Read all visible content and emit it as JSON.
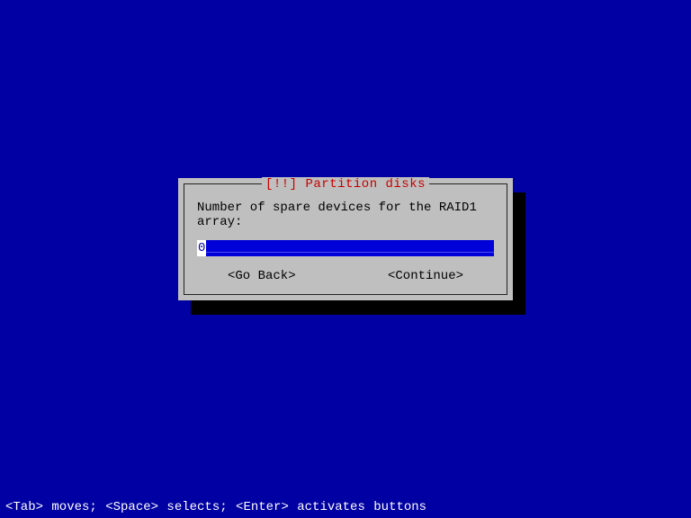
{
  "dialog": {
    "title_marker": "[!!]",
    "title_text": "Partition disks",
    "prompt": "Number of spare devices for the RAID1 array:",
    "input_value": "0",
    "input_fill": "________________________________________________",
    "buttons": {
      "back": "<Go Back>",
      "continue": "<Continue>"
    }
  },
  "footer": "<Tab> moves; <Space> selects; <Enter> activates buttons"
}
